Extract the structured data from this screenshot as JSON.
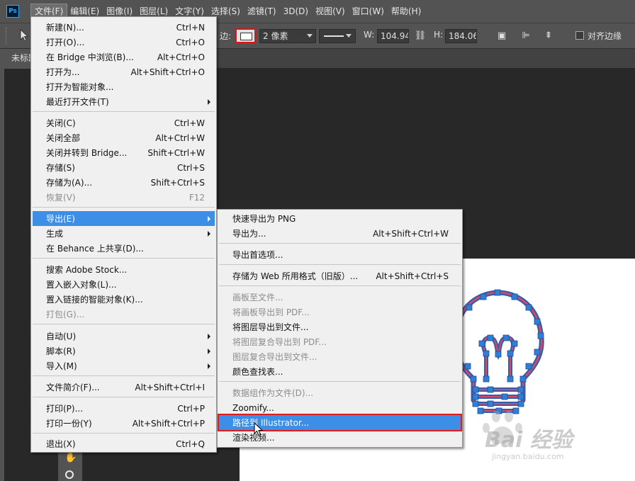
{
  "app": {
    "logo": "Ps"
  },
  "menubar": {
    "items": [
      "文件(F)",
      "编辑(E)",
      "图像(I)",
      "图层(L)",
      "文字(Y)",
      "选择(S)",
      "滤镜(T)",
      "3D(D)",
      "视图(V)",
      "窗口(W)",
      "帮助(H)"
    ]
  },
  "options": {
    "stroke_label": "边:",
    "stroke_width": "2 像素",
    "w_label": "W:",
    "w_value": "104.94 |",
    "h_label": "H:",
    "h_value": "184.06 |",
    "align_edges_label": "对齐边缘",
    "stroke_color": "#d81818"
  },
  "document": {
    "tab_title": "未标题"
  },
  "file_menu": {
    "items": [
      {
        "label": "新建(N)...",
        "shortcut": "Ctrl+N"
      },
      {
        "label": "打开(O)...",
        "shortcut": "Ctrl+O"
      },
      {
        "label": "在 Bridge 中浏览(B)...",
        "shortcut": "Alt+Ctrl+O"
      },
      {
        "label": "打开为...",
        "shortcut": "Alt+Shift+Ctrl+O"
      },
      {
        "label": "打开为智能对象...",
        "shortcut": ""
      },
      {
        "label": "最近打开文件(T)",
        "shortcut": ""
      },
      {
        "label": "关闭(C)",
        "shortcut": "Ctrl+W"
      },
      {
        "label": "关闭全部",
        "shortcut": "Alt+Ctrl+W"
      },
      {
        "label": "关闭并转到 Bridge...",
        "shortcut": "Shift+Ctrl+W"
      },
      {
        "label": "存储(S)",
        "shortcut": "Ctrl+S"
      },
      {
        "label": "存储为(A)...",
        "shortcut": "Shift+Ctrl+S"
      },
      {
        "label": "恢复(V)",
        "shortcut": "F12"
      },
      {
        "label": "导出(E)",
        "shortcut": ""
      },
      {
        "label": "生成",
        "shortcut": ""
      },
      {
        "label": "在 Behance 上共享(D)...",
        "shortcut": ""
      },
      {
        "label": "搜索 Adobe Stock...",
        "shortcut": ""
      },
      {
        "label": "置入嵌入对象(L)...",
        "shortcut": ""
      },
      {
        "label": "置入链接的智能对象(K)...",
        "shortcut": ""
      },
      {
        "label": "打包(G)...",
        "shortcut": ""
      },
      {
        "label": "自动(U)",
        "shortcut": ""
      },
      {
        "label": "脚本(R)",
        "shortcut": ""
      },
      {
        "label": "导入(M)",
        "shortcut": ""
      },
      {
        "label": "文件简介(F)...",
        "shortcut": "Alt+Shift+Ctrl+I"
      },
      {
        "label": "打印(P)...",
        "shortcut": "Ctrl+P"
      },
      {
        "label": "打印一份(Y)",
        "shortcut": "Alt+Shift+Ctrl+P"
      },
      {
        "label": "退出(X)",
        "shortcut": "Ctrl+Q"
      }
    ]
  },
  "export_menu": {
    "items": [
      {
        "label": "快速导出为 PNG",
        "shortcut": ""
      },
      {
        "label": "导出为...",
        "shortcut": "Alt+Shift+Ctrl+W"
      },
      {
        "label": "导出首选项...",
        "shortcut": ""
      },
      {
        "label": "存储为 Web 所用格式（旧版）...",
        "shortcut": "Alt+Shift+Ctrl+S"
      },
      {
        "label": "画板至文件...",
        "shortcut": ""
      },
      {
        "label": "将画板导出到 PDF...",
        "shortcut": ""
      },
      {
        "label": "将图层导出到文件...",
        "shortcut": ""
      },
      {
        "label": "将图层复合导出到 PDF...",
        "shortcut": ""
      },
      {
        "label": "图层复合导出到文件...",
        "shortcut": ""
      },
      {
        "label": "颜色查找表...",
        "shortcut": ""
      },
      {
        "label": "数据组作为文件(D)...",
        "shortcut": ""
      },
      {
        "label": "Zoomify...",
        "shortcut": ""
      },
      {
        "label": "路径到 Illustrator...",
        "shortcut": ""
      },
      {
        "label": "渲染视频...",
        "shortcut": ""
      }
    ]
  },
  "watermark": {
    "text": "Bai 经验",
    "url": "jingyan.baidu.com"
  }
}
